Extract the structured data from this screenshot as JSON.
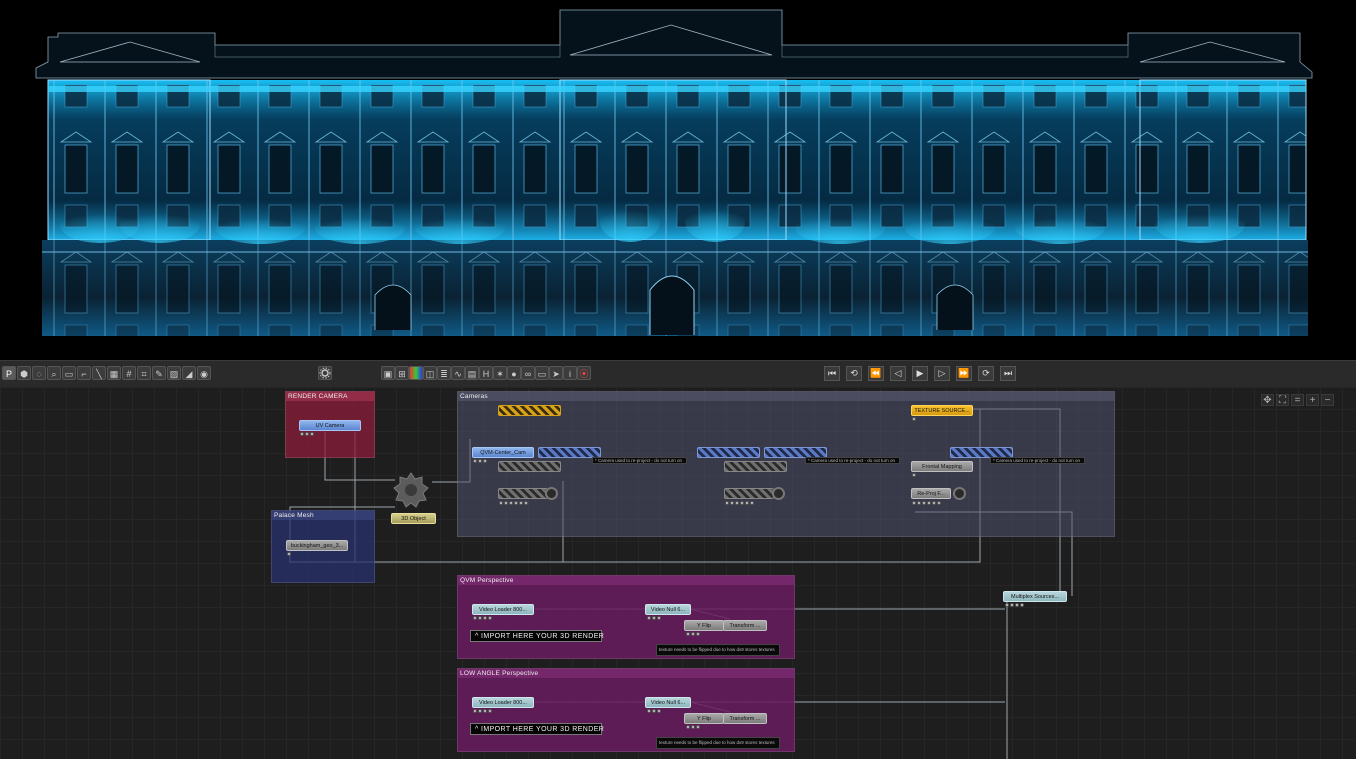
{
  "toolbar": {
    "mode_label": "P",
    "tool_icons": [
      "hexagon-tool-icon",
      "lasso-tool-icon",
      "zoom-tool-icon",
      "select-tool-icon",
      "wire-tool-icon",
      "line-tool-icon",
      "grid-tool-icon",
      "number-tool-icon",
      "crop-tool-icon",
      "paint-tool-icon",
      "hatch-tool-icon",
      "ramp-tool-icon",
      "circle-tool-icon"
    ],
    "settings_icon": "gear-icon",
    "view_icons": [
      "display-icon",
      "grid-view-icon",
      "color-icon",
      "cube-icon",
      "layers-icon",
      "curve-icon",
      "panel-icon",
      "hd-icon",
      "star-icon",
      "sphere-icon",
      "link-icon",
      "screen-icon",
      "cursor-icon",
      "info-icon",
      "record-icon"
    ],
    "transport": [
      "skip-start-icon",
      "loop-icon",
      "rewind-icon",
      "step-back-icon",
      "play-icon",
      "step-forward-icon",
      "fast-forward-icon",
      "cycle-icon",
      "skip-end-icon"
    ]
  },
  "view_controls": [
    "pan-icon",
    "fit-icon",
    "equal-icon",
    "zoom-in-icon",
    "zoom-out-icon"
  ],
  "groups": {
    "render_camera": "RENDER CAMERA",
    "palace_mesh": "Palace Mesh",
    "cameras": "Cameras",
    "qvm_perspective": "QVM Perspective",
    "low_angle": "LOW ANGLE Perspective"
  },
  "nodes": {
    "uv_camera": "UV Camera",
    "qvm_center_cam": "QVM-Center_Cam",
    "texture_source": "TEXTURE SOURCE...",
    "frontal_mapping": "Frontal Mapping",
    "re_proj": "Re-Proj F...",
    "object_3d": "3D Object",
    "buckingham_geo": "buckingham_geo_3...",
    "multiplex_sources": "Multiplex Sources...",
    "qvm_video_loader": "Video Loader 800...",
    "qvm_video_null": "Video Null 6...",
    "qvm_y_flip": "Y Flip",
    "qvm_transform": "Transform ...",
    "low_video_loader": "Video Loader 800...",
    "low_video_null": "Video Null 6...",
    "low_y_flip": "Y Flip",
    "low_transform": "Transform ..."
  },
  "notes": {
    "camera_note": "* Camera used to re-project - do not turn on",
    "camera_note_2": "* Camera used to re-project - do not turn on",
    "camera_note_3": "* Camera used to re-project - do not turn on",
    "qvm_import": "^ IMPORT HERE YOUR 3D RENDER",
    "low_import": "^ IMPORT HERE YOUR 3D RENDER",
    "qvm_flip_note": "texture needs to be flipped due to how dx9 stores textures",
    "low_flip_note": "texture needs to be flipped due to how dx9 stores textures"
  },
  "colors": {
    "projection_glow": "#18b4ff",
    "render_camera_group": "#7a2035",
    "palace_mesh_group": "#27305e",
    "cameras_group": "#44455a",
    "perspective_group": "#5e1b58"
  }
}
